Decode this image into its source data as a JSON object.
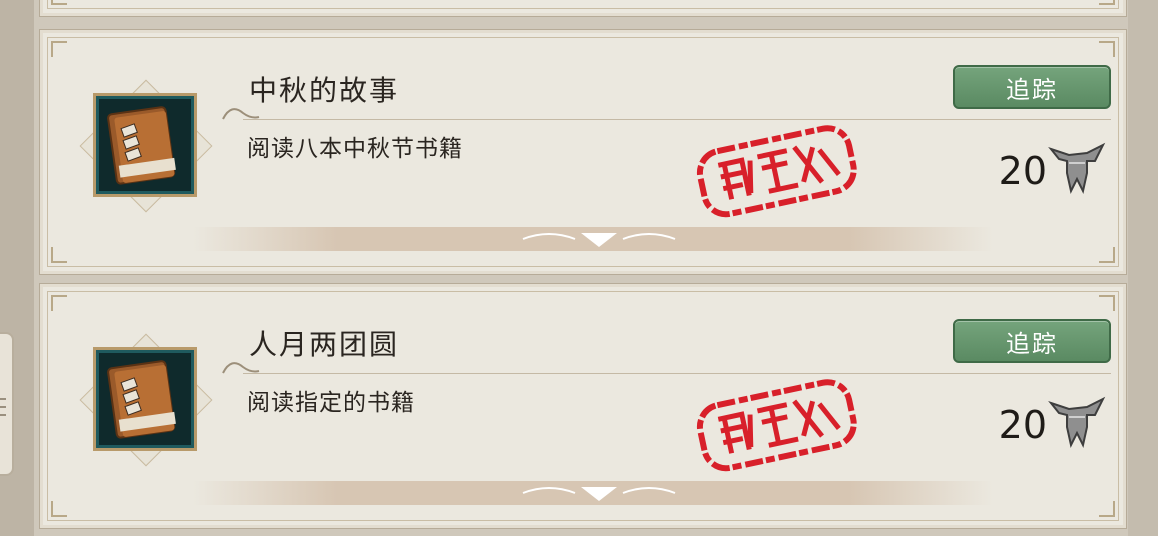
{
  "quests": [
    {
      "title": "中秋的故事",
      "description": "阅读八本中秋节书籍",
      "track_button": "追踪",
      "reward_amount": "20",
      "reward_icon": "bronze-vessel-icon",
      "item_icon": "book-icon",
      "stamp": "red-seal-stamp"
    },
    {
      "title": "人月两团圆",
      "description": "阅读指定的书籍",
      "track_button": "追踪",
      "reward_amount": "20",
      "reward_icon": "bronze-vessel-icon",
      "item_icon": "book-icon",
      "stamp": "red-seal-stamp"
    }
  ],
  "colors": {
    "card_bg": "#ebe8df",
    "track_button": "#68976f",
    "stamp_red": "#d8202a"
  }
}
